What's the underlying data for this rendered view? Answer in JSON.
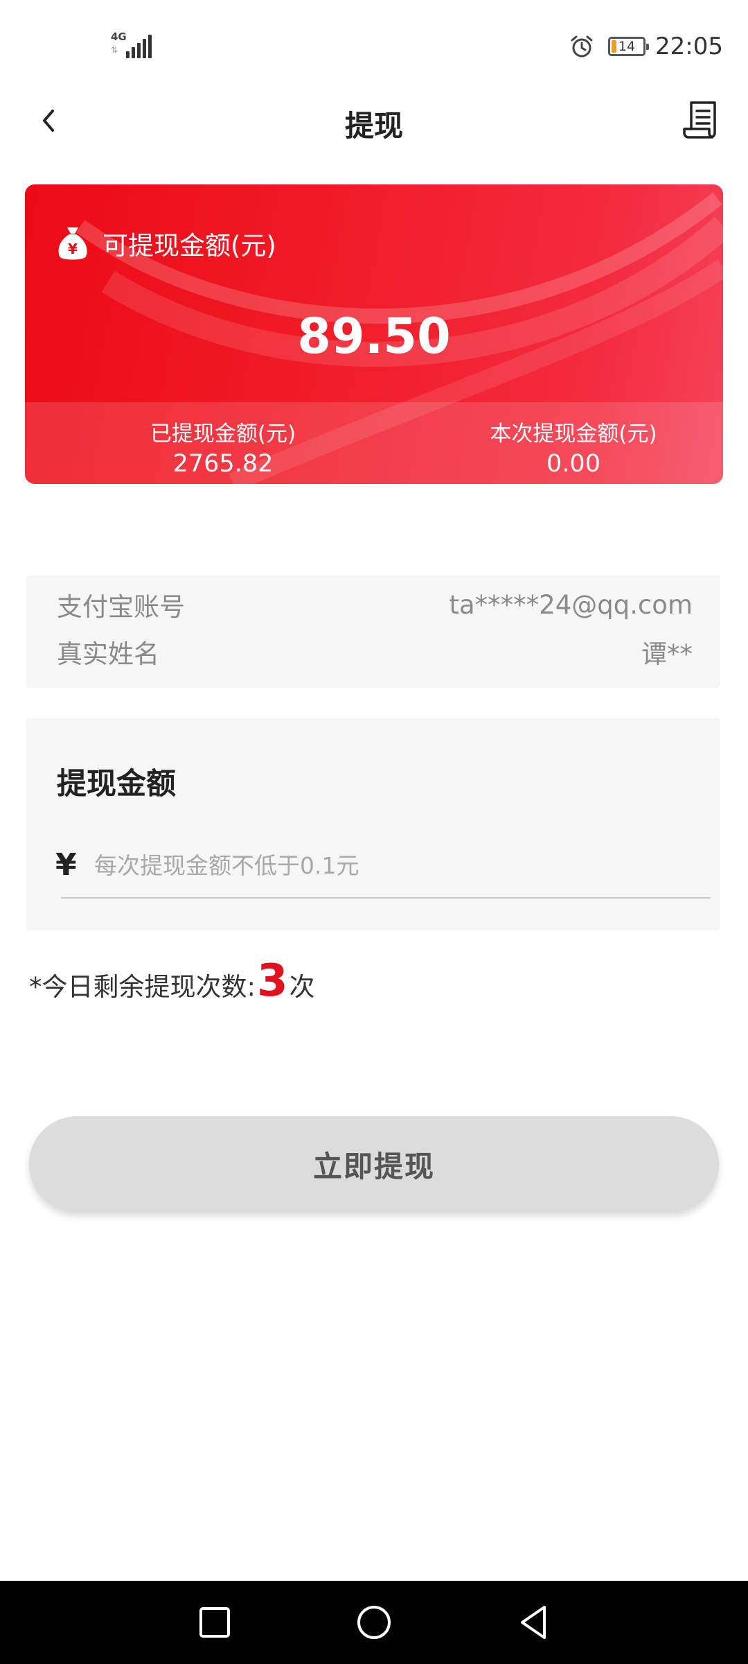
{
  "status_bar": {
    "network": "4G",
    "time": "22:05",
    "battery_level": "14",
    "battery_color": "#f39b1e",
    "icons": [
      "signal-icon",
      "alarm-icon",
      "battery-icon"
    ]
  },
  "header": {
    "title": "提现",
    "back_icon": "chevron-left-icon",
    "record_icon": "receipt-list-icon"
  },
  "balance_card": {
    "label": "可提现金额(元)",
    "amount": "89.50",
    "icon": "money-bag-icon",
    "withdrawn_label": "已提现金额(元)",
    "withdrawn_value": "2765.82",
    "current_label": "本次提现金额(元)",
    "current_value": "0.00",
    "accent_color": "#ec0a16"
  },
  "account": {
    "alipay_label": "支付宝账号",
    "alipay_value": "ta*****24@qq.com",
    "name_label": "真实姓名",
    "name_value": "谭**"
  },
  "amount_form": {
    "title": "提现金额",
    "currency": "¥",
    "placeholder": "每次提现金额不低于0.1元",
    "value": ""
  },
  "remaining": {
    "prefix": "*今日剩余提现次数:",
    "count": "3",
    "suffix": "次",
    "count_color": "#e2101c"
  },
  "withdraw_button": {
    "label": "立即提现"
  },
  "nav_bar": {
    "icons": [
      "square-recent-apps-icon",
      "circle-home-icon",
      "triangle-back-icon"
    ]
  }
}
